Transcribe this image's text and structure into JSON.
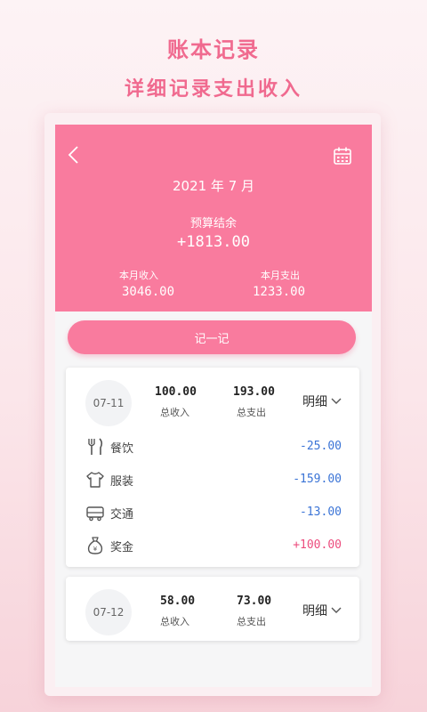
{
  "promo": {
    "title": "账本记录",
    "subtitle": "详细记录支出收入"
  },
  "header": {
    "month": "2021 年 7 月",
    "budget_label": "预算结余",
    "budget_value": "+1813.00",
    "income_label": "本月收入",
    "income_value": "3046.00",
    "expense_label": "本月支出",
    "expense_value": "1233.00"
  },
  "record_button": "记一记",
  "days": [
    {
      "date": "07-11",
      "income": "100.00",
      "income_label": "总收入",
      "expense": "193.00",
      "expense_label": "总支出",
      "detail_label": "明细",
      "items": [
        {
          "icon": "fork-knife-icon",
          "name": "餐饮",
          "amount": "-25.00"
        },
        {
          "icon": "shirt-icon",
          "name": "服装",
          "amount": "-159.00"
        },
        {
          "icon": "car-icon",
          "name": "交通",
          "amount": "-13.00"
        },
        {
          "icon": "money-bag-icon",
          "name": "奖金",
          "amount": "+100.00"
        }
      ]
    },
    {
      "date": "07-12",
      "income": "58.00",
      "income_label": "总收入",
      "expense": "73.00",
      "expense_label": "总支出",
      "detail_label": "明细",
      "items": []
    }
  ],
  "colors": {
    "accent": "#f97b9e",
    "expense": "#3b74d6",
    "income": "#ec4d7e"
  }
}
